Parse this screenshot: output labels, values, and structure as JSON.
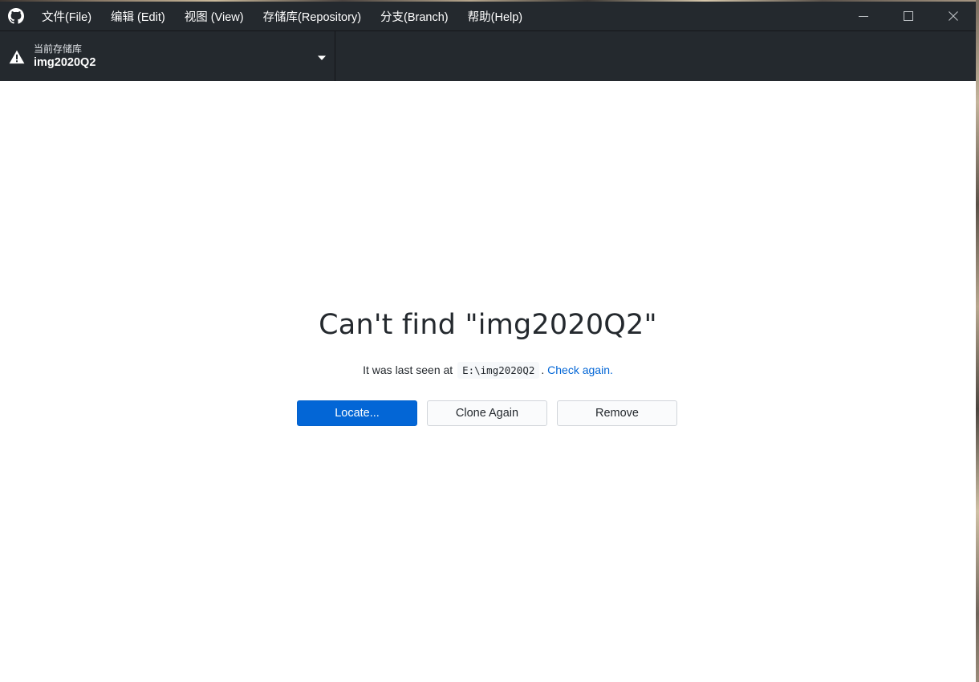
{
  "menubar": {
    "app_icon": "github-octocat-icon",
    "items": [
      {
        "label": "文件(File)"
      },
      {
        "label": "编辑 (Edit)"
      },
      {
        "label": "视图 (View)"
      },
      {
        "label": "存储库(Repository)"
      },
      {
        "label": "分支(Branch)"
      },
      {
        "label": "帮助(Help)"
      }
    ],
    "window_controls": [
      "minimize-icon",
      "maximize-icon",
      "close-icon"
    ]
  },
  "toolbar": {
    "repository": {
      "caption": "当前存储库",
      "name": "img2020Q2",
      "status_icon": "warning-icon",
      "dropdown_icon": "triangle-down-icon"
    }
  },
  "missing_repo": {
    "title": "Can't find \"img2020Q2\"",
    "desc_prefix": "It was last seen at",
    "path": "E:\\img2020Q2",
    "desc_period": ".",
    "check_again": "Check again."
  },
  "buttons": {
    "locate": "Locate...",
    "clone_again": "Clone Again",
    "remove": "Remove"
  },
  "colors": {
    "chrome": "#24292e",
    "primary": "#0366d6",
    "link": "#0366d6",
    "text": "#24292e"
  }
}
